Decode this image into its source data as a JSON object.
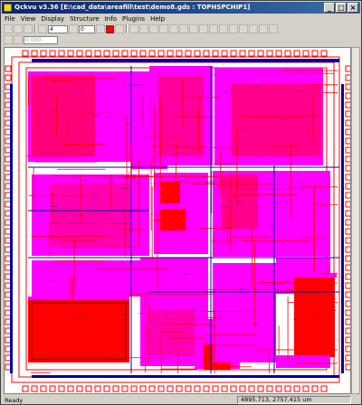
{
  "window": {
    "title": "Qckvu v3.36 [E:\\cad_data\\areafill\\test\\demo8.gds : TOPHSPCHIP1]"
  },
  "menu": [
    "File",
    "View",
    "Display",
    "Structure",
    "Info",
    "Plugins",
    "Help"
  ],
  "toolbar": {
    "field_a": "4",
    "field_b": "0",
    "field_c": "0.000"
  },
  "status": {
    "text": "Ready",
    "coords": "4895.713, 2757.415 um"
  },
  "colors": {
    "layer_red": "#ff0000",
    "layer_magenta": "#ff00ff",
    "layer_navy": "#0000a0",
    "background": "#ffffff"
  }
}
